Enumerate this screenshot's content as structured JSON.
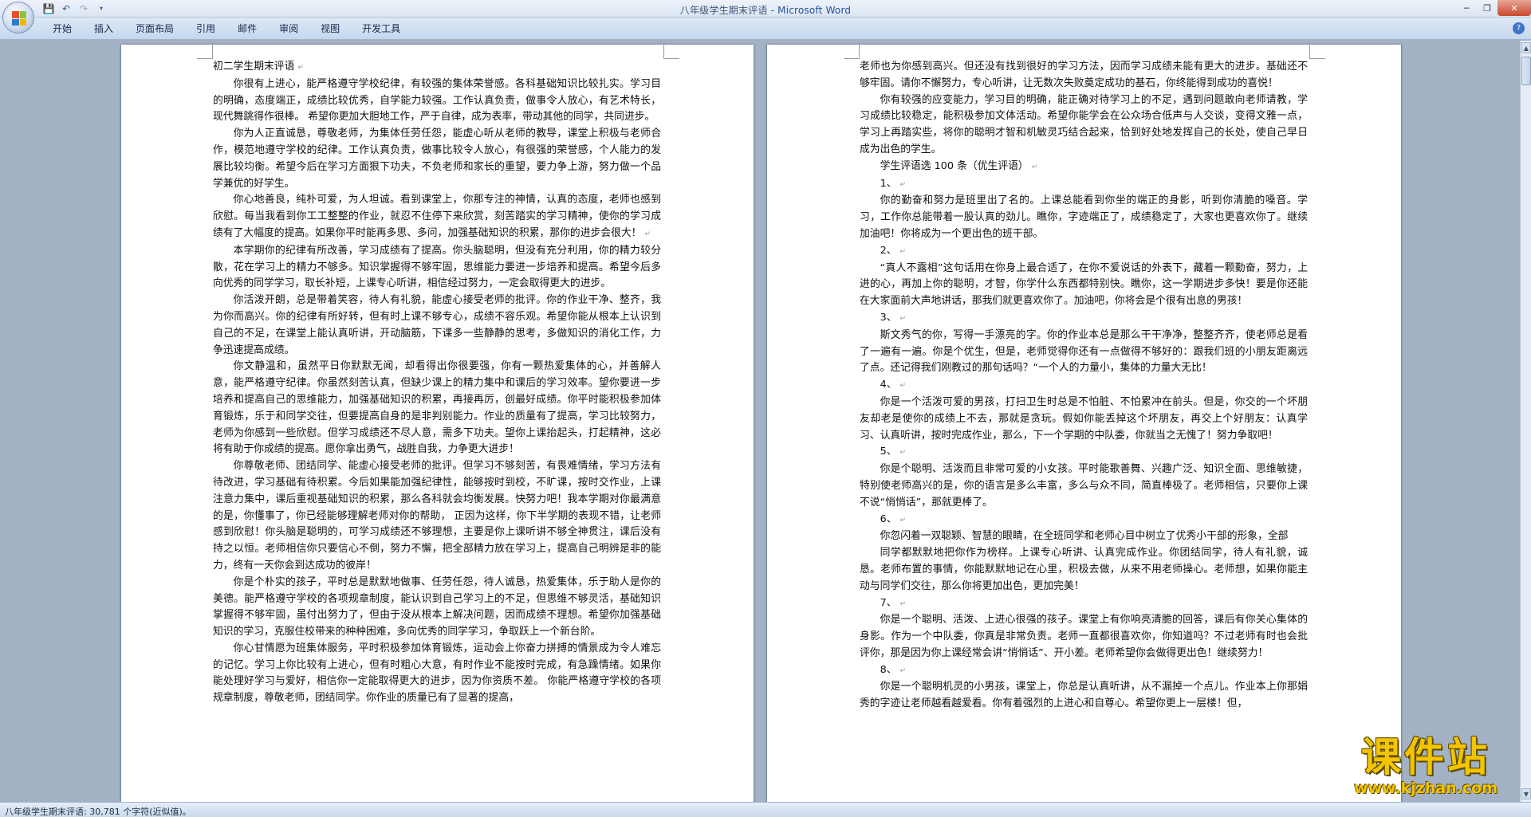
{
  "window": {
    "doc_name": "八年级学生期末评语",
    "separator": " - ",
    "app_name": "Microsoft Word"
  },
  "tabs": [
    "开始",
    "插入",
    "页面布局",
    "引用",
    "邮件",
    "审阅",
    "视图",
    "开发工具"
  ],
  "icons": {
    "office_button": "office-logo-icon",
    "save": "save-icon",
    "undo": "undo-icon",
    "redo": "redo-icon",
    "customize": "dropdown-arrow-icon",
    "help": "help-icon"
  },
  "colors": {
    "title_blue": "#2450a0",
    "watermark": "#f3c400",
    "workspace": "#a3b1c4"
  },
  "left_page": [
    {
      "indent": false,
      "text": "初二学生期末评语",
      "mark": true
    },
    {
      "indent": true,
      "text": "你很有上进心，能严格遵守学校纪律，有较强的集体荣誉感。各科基础知识比较扎实。学习目的明确，态度端正，成绩比较优秀，自学能力较强。工作认真负责，做事令人放心，有艺术特长，现代舞跳得作很棒。 希望你更加大胆地工作，严于自律，成为表率，带动其他的同学，共同进步。",
      "mark": false
    },
    {
      "indent": true,
      "text": "你为人正直诚恳，尊敬老师，为集体任劳任怨，能虚心听从老师的教导，课堂上积极与老师合作，模范地遵守学校的纪律。工作认真负责，做事比较令人放心，有很强的荣誉感，个人能力的发展比较均衡。希望今后在学习方面狠下功夫，不负老师和家长的重望，要力争上游，努力做一个品学兼优的好学生。",
      "mark": false
    },
    {
      "indent": true,
      "text": "你心地善良，纯朴可爱，为人坦诚。看到课堂上，你那专注的神情，认真的态度，老师也感到欣慰。每当我看到你工工整整的作业，就忍不住停下来欣赏，刻苦踏实的学习精神，使你的学习成绩有了大幅度的提高。如果你平时能再多思、多问，加强基础知识的积累，那你的进步会很大！",
      "mark": true
    },
    {
      "indent": true,
      "text": "本学期你的纪律有所改善，学习成绩有了提高。你头脑聪明，但没有充分利用，你的精力较分散，花在学习上的精力不够多。知识掌握得不够牢固，思维能力要进一步培养和提高。希望今后多向优秀的同学学习，取长补短，上课专心听讲，相信经过努力，一定会取得更大的进步。",
      "mark": false
    },
    {
      "indent": true,
      "text": "你活泼开朗，总是带着笑容，待人有礼貌，能虚心接受老师的批评。你的作业干净、整齐，我为你而高兴。你的纪律有所好转，但有时上课不够专心，成绩不容乐观。希望你能从根本上认识到自己的不足，在课堂上能认真听讲，开动脑筋，下课多一些静静的思考，多做知识的消化工作，力争迅速提高成绩。",
      "mark": false
    },
    {
      "indent": true,
      "text": "你文静温和，虽然平日你默默无闻，却看得出你很要强，你有一颗热爱集体的心，并善解人意，能严格遵守纪律。你虽然刻苦认真，但缺少课上的精力集中和课后的学习效率。望你要进一步培养和提高自己的思维能力，加强基础知识的积累，再接再厉，创最好成绩。你平时能积极参加体育锻炼，乐于和同学交往，但要提高自身的是非判别能力。作业的质量有了提高，学习比较努力，老师为你感到一些欣慰。但学习成绩还不尽人意，需多下功夫。望你上课抬起头，打起精神，这必将有助于你成绩的提高。愿你拿出勇气，战胜自我，力争更大进步！",
      "mark": false
    },
    {
      "indent": true,
      "text": "你尊敬老师、团结同学、能虚心接受老师的批评。但学习不够刻苦，有畏难情绪，学习方法有待改进，学习基础有待积累。今后如果能加强纪律性，能够按时到校，不旷课，按时交作业，上课注意力集中，课后重视基础知识的积累，那么各科就会均衡发展。快努力吧！我本学期对你最满意的是，你懂事了，你已经能够理解老师对你的帮助， 正因为这样，你下半学期的表现不错，让老师感到欣慰！你头脑是聪明的，可学习成绩还不够理想，主要是你上课听讲不够全神贯注，课后没有持之以恒。老师相信你只要信心不倒，努力不懈，把全部精力放在学习上，提高自己明辨是非的能力，终有一天你会到达成功的彼岸！",
      "mark": false
    },
    {
      "indent": true,
      "text": "你是个朴实的孩子，平时总是默默地做事、任劳任怨，待人诚恳，热爱集体，乐于助人是你的美德。能严格遵守学校的各项规章制度，能认识到自己学习上的不足，但思维不够灵活，基础知识掌握得不够牢固，虽付出努力了，但由于没从根本上解决问题，因而成绩不理想。希望你加强基础知识的学习，克服住校带来的种种困难，多向优秀的同学学习，争取跃上一个新台阶。",
      "mark": false
    },
    {
      "indent": true,
      "text": "你心甘情愿为班集体服务，平时积极参加体育锻炼，运动会上你奋力拼搏的情景成为令人难忘的记忆。学习上你比较有上进心，但有时粗心大意，有时作业不能按时完成，有急躁情绪。如果你能处理好学习与爱好，相信你一定能取得更大的进步，因为你资质不差。 你能严格遵守学校的各项规章制度，尊敬老师，团结同学。你作业的质量已有了显著的提高，",
      "mark": false
    }
  ],
  "right_page": [
    {
      "indent": false,
      "text": "老师也为你感到高兴。但还没有找到很好的学习方法，因而学习成绩未能有更大的进步。基础还不够牢固。请你不懈努力，专心听讲，让无数次失败奠定成功的基石，你终能得到成功的喜悦！",
      "mark": false
    },
    {
      "indent": true,
      "text": "你有较强的应变能力，学习目的明确，能正确对待学习上的不足，遇到问题敢向老师请教，学习成绩比较稳定，能积极参加文体活动。希望你能学会在公众场合低声与人交谈，变得文雅一点，学习上再踏实些，将你的聪明才智和机敏灵巧结合起来，恰到好处地发挥自己的长处，使自己早日成为出色的学生。",
      "mark": false
    },
    {
      "indent": true,
      "text": "学生评语选 100 条（优生评语）",
      "mark": true
    },
    {
      "indent": true,
      "text": "1、",
      "mark": true
    },
    {
      "indent": true,
      "text": "你的勤奋和努力是班里出了名的。上课总能看到你坐的端正的身影，听到你清脆的嗓音。学习，工作你总能带着一股认真的劲儿。瞧你，字迹端正了，成绩稳定了，大家也更喜欢你了。继续加油吧！你将成为一个更出色的班干部。",
      "mark": false
    },
    {
      "indent": true,
      "text": "2、",
      "mark": true
    },
    {
      "indent": true,
      "text": "“真人不露相”这句话用在你身上最合适了，在你不爱说话的外表下，藏着一颗勤奋，努力，上进的心，再加上你的聪明，才智，你学什么东西都特别快。瞧你，这一学期进步多快！要是你还能在大家面前大声地讲话，那我们就更喜欢你了。加油吧，你将会是个很有出息的男孩！",
      "mark": false
    },
    {
      "indent": true,
      "text": "3、",
      "mark": true
    },
    {
      "indent": true,
      "text": "斯文秀气的你，写得一手漂亮的字。你的作业本总是那么干干净净，整整齐齐，使老师总是看了一遍有一遍。你是个优生，但是，老师觉得你还有一点做得不够好的：跟我们班的小朋友距离远了点。还记得我们刚教过的那句话吗？“一个人的力量小，集体的力量大无比！",
      "mark": false
    },
    {
      "indent": true,
      "text": "4、",
      "mark": true
    },
    {
      "indent": true,
      "text": "你是一个活泼可爱的男孩，打扫卫生时总是不怕脏、不怕累冲在前头。但是，你交的一个坏朋友却老是使你的成绩上不去，那就是贪玩。假如你能丢掉这个坏朋友，再交上个好朋友：认真学习、认真听讲，按时完成作业，那么，下一个学期的中队委，你就当之无愧了！努力争取吧！",
      "mark": false
    },
    {
      "indent": true,
      "text": "5、",
      "mark": true
    },
    {
      "indent": true,
      "text": "你是个聪明、活泼而且非常可爱的小女孩。平时能歌善舞、兴趣广泛、知识全面、思维敏捷，特别使老师高兴的是，你的语言是多么丰富，多么与众不同，简直棒极了。老师相信，只要你上课不说“悄悄话”，那就更棒了。",
      "mark": false
    },
    {
      "indent": true,
      "text": "6、",
      "mark": true
    },
    {
      "indent": true,
      "text": "你忽闪着一双聪颖、智慧的眼睛，在全班同学和老师心目中树立了优秀小干部的形象，全部",
      "mark": false
    },
    {
      "indent": true,
      "text": "同学都默默地把你作为榜样。上课专心听讲、认真完成作业。你团结同学，待人有礼貌，诚恳。老师布置的事情，你能默默地记在心里，积极去做，从来不用老师操心。老师想，如果你能主动与同学们交往，那么你将更加出色，更加完美！",
      "mark": false
    },
    {
      "indent": true,
      "text": "7、",
      "mark": true
    },
    {
      "indent": true,
      "text": "你是一个聪明、活泼、上进心很强的孩子。课堂上有你响亮清脆的回答，课后有你关心集体的身影。作为一个中队委，你真是非常负责。老师一直都很喜欢你，你知道吗？不过老师有时也会批评你，那是因为你上课经常会讲“悄悄话”、开小差。老师希望你会做得更出色！继续努力！",
      "mark": false
    },
    {
      "indent": true,
      "text": "8、",
      "mark": true
    },
    {
      "indent": true,
      "text": "你是一个聪明机灵的小男孩，课堂上，你总是认真听讲，从不漏掉一个点儿。作业本上你那娟秀的字迹让老师越看越爱看。你有着强烈的上进心和自尊心。希望你更上一层楼！但，",
      "mark": false
    }
  ],
  "status": {
    "text": "八年级学生期末评语: 30,781 个字符(近似值)。"
  },
  "watermark": {
    "title": "课件站",
    "url": "www.kjzhan.com"
  }
}
